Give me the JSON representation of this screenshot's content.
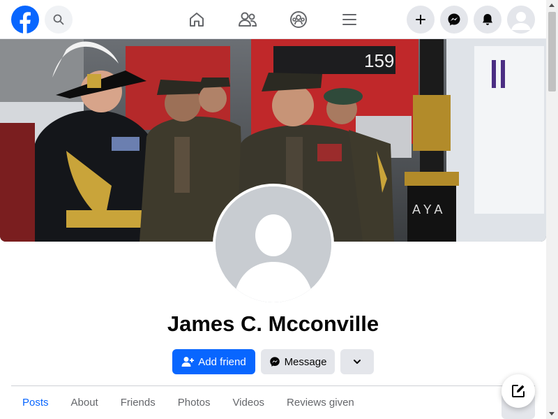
{
  "profile": {
    "name": "James C. Mcconville",
    "cover_bus_sign": "159",
    "cover_lamp_letters": "A Y A"
  },
  "actions": {
    "add_friend": "Add friend",
    "message": "Message"
  },
  "tabs": [
    {
      "label": "Posts",
      "active": true
    },
    {
      "label": "About",
      "active": false
    },
    {
      "label": "Friends",
      "active": false
    },
    {
      "label": "Photos",
      "active": false
    },
    {
      "label": "Videos",
      "active": false
    },
    {
      "label": "Reviews given",
      "active": false
    }
  ],
  "colors": {
    "brand": "#0866ff",
    "secondary_button": "#e4e6eb",
    "muted_text": "#65676b"
  },
  "icons": [
    "facebook-logo-icon",
    "search-icon",
    "home-icon",
    "friends-icon",
    "groups-icon",
    "menu-icon",
    "plus-icon",
    "messenger-icon",
    "bell-icon",
    "chevron-down-icon",
    "compose-icon"
  ]
}
